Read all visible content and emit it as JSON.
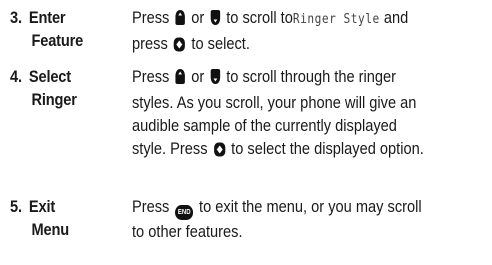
{
  "steps": [
    {
      "number": "3.",
      "title_lines": [
        "Enter",
        "Feature"
      ],
      "body": {
        "l1_a": "Press",
        "l1_b": "or",
        "l1_c": "to scroll to",
        "l1_mono": "Ringer Style",
        "l1_d": "and",
        "l2_a": "press",
        "l2_b": "to select."
      }
    },
    {
      "number": "4.",
      "title_lines": [
        "Select",
        "Ringer"
      ],
      "body": {
        "l1_a": "Press",
        "l1_b": "or",
        "l1_c": "to scroll through the ringer",
        "l2": "styles. As you scroll, your phone will give an",
        "l3": "audible sample of the currently displayed",
        "l4_a": "style. Press",
        "l4_b": "to select the displayed option."
      }
    },
    {
      "number": "5.",
      "title_lines": [
        "Exit",
        "Menu"
      ],
      "body": {
        "l1_a": "Press",
        "l1_icon_text": "END",
        "l1_b": "to exit the menu, or you may scroll",
        "l2": "to other features."
      }
    }
  ],
  "icons": {
    "nav_up": "nav-up-icon",
    "nav_down": "nav-down-icon",
    "select": "select-icon",
    "end_key": "end-key-icon"
  }
}
